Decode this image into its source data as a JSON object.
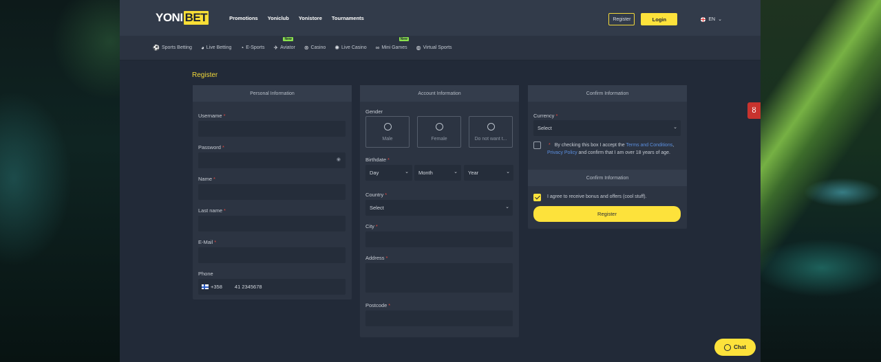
{
  "header": {
    "logo": {
      "part1": "YONI",
      "part2": "BET"
    },
    "nav": [
      "Promotions",
      "Yoniclub",
      "Yonistore",
      "Tournaments"
    ],
    "register_label": "Register",
    "login_label": "Login",
    "language": "EN"
  },
  "subnav": [
    {
      "label": "Sports Betting",
      "icon": "soccer-ball-icon"
    },
    {
      "label": "Live Betting",
      "icon": "live-ball-icon"
    },
    {
      "label": "E-Sports",
      "icon": "esports-icon"
    },
    {
      "label": "Aviator",
      "icon": "plane-icon",
      "badge": "New"
    },
    {
      "label": "Casino",
      "icon": "gamepad-icon"
    },
    {
      "label": "Live Casino",
      "icon": "live-casino-icon"
    },
    {
      "label": "Mini Games",
      "icon": "mini-games-icon",
      "badge": "New"
    },
    {
      "label": "Virtual Sports",
      "icon": "virtual-sports-icon"
    }
  ],
  "page_title": "Register",
  "personal": {
    "title": "Personal Information",
    "username_label": "Username",
    "password_label": "Password",
    "name_label": "Name",
    "lastname_label": "Last name",
    "email_label": "E-Mail",
    "phone_label": "Phone",
    "phone_code": "+358",
    "phone_value": "41 2345678"
  },
  "account": {
    "title": "Account Information",
    "gender_label": "Gender",
    "gender_options": [
      "Male",
      "Female",
      "Do not want t..."
    ],
    "birthdate_label": "Birthdate",
    "day": "Day",
    "month": "Month",
    "year": "Year",
    "country_label": "Country",
    "country_value": "Select",
    "city_label": "City",
    "address_label": "Address",
    "postcode_label": "Postcode"
  },
  "confirm": {
    "title": "Confirm Information",
    "currency_label": "Currency",
    "currency_value": "Select",
    "terms_prefix": "By checking this box I accept the",
    "terms_link": "Terms and Conditions",
    "terms_sep": ",",
    "privacy_link": "Privacy Policy",
    "terms_suffix": "and confirm that I am over 18 years of age.",
    "title2": "Confirm Information",
    "bonus_label": "I agree to receive bonus and offers (cool stuff).",
    "register_button": "Register"
  },
  "required_mark": "*",
  "chat_label": "Chat",
  "colors": {
    "accent": "#fde23b",
    "required": "#e2463f",
    "link": "#5b8fe0",
    "panel": "#2c3442"
  }
}
